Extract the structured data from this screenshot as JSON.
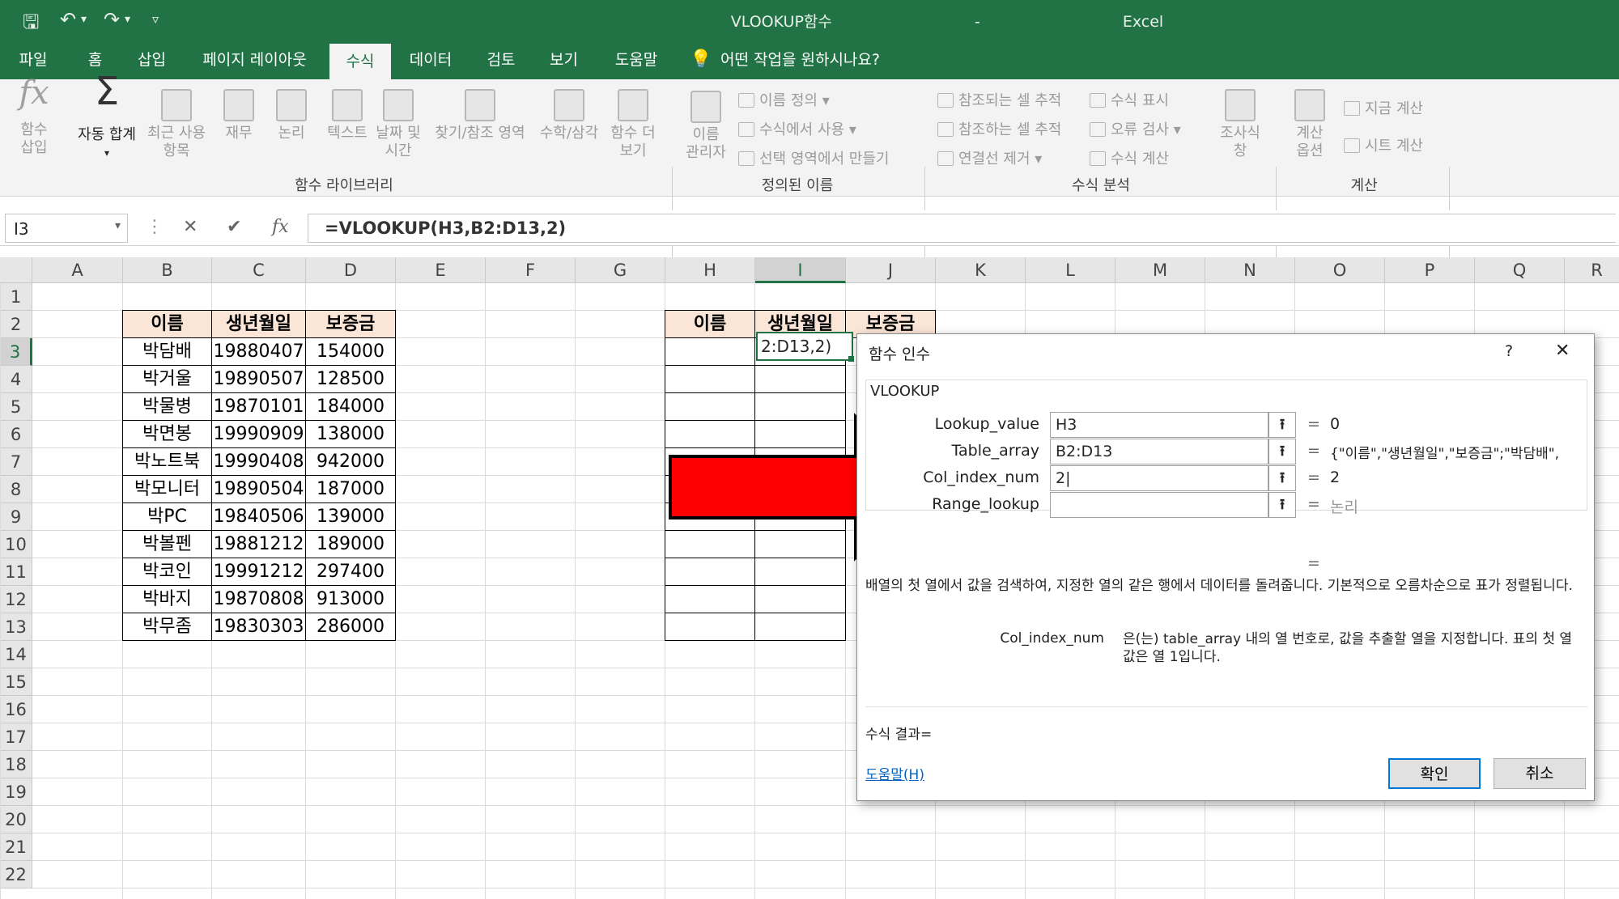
{
  "window": {
    "title": "VLOOKUP함수",
    "app": "Excel",
    "sep": "-"
  },
  "qat": {
    "save_icon": "save-icon",
    "undo_icon": "undo-icon",
    "redo_icon": "redo-icon"
  },
  "tabs": [
    {
      "label": "파일"
    },
    {
      "label": "홈"
    },
    {
      "label": "삽입"
    },
    {
      "label": "페이지 레이아웃"
    },
    {
      "label": "수식",
      "active": true
    },
    {
      "label": "데이터"
    },
    {
      "label": "검토"
    },
    {
      "label": "보기"
    },
    {
      "label": "도움말"
    }
  ],
  "tell_me": "어떤 작업을 원하시나요?",
  "ribbon": {
    "lib": {
      "insert_fn": "함수\n삽입",
      "autosum": "자동 합계",
      "recent": "최근 사용\n항목",
      "finance": "재무",
      "logic": "논리",
      "text": "텍스트",
      "datetime": "날짜 및\n시간",
      "lookup": "찾기/참조 영역",
      "math": "수학/삼각",
      "more": "함수 더\n보기",
      "group": "함수 라이브러리"
    },
    "names": {
      "manager": "이름\n관리자",
      "define": "이름 정의",
      "use": "수식에서 사용",
      "create": "선택 영역에서 만들기",
      "group": "정의된 이름"
    },
    "audit": {
      "precedents": "참조되는 셀 추적",
      "dependents": "참조하는 셀 추적",
      "remove": "연결선 제거",
      "show": "수식 표시",
      "error": "오류 검사",
      "evaluate": "수식 계산",
      "watch": "조사식\n창",
      "group": "수식 분석"
    },
    "calc": {
      "options": "계산\n옵션",
      "now": "지금 계산",
      "sheet": "시트 계산",
      "group": "계산"
    }
  },
  "formula_bar": {
    "name_box": "I3",
    "formula": "=VLOOKUP(H3,B2:D13,2)"
  },
  "columns": [
    "A",
    "B",
    "C",
    "D",
    "E",
    "F",
    "G",
    "H",
    "I",
    "J",
    "K",
    "L",
    "M",
    "N",
    "O",
    "P",
    "Q",
    "R"
  ],
  "rows": [
    "1",
    "2",
    "3",
    "4",
    "5",
    "6",
    "7",
    "8",
    "9",
    "10",
    "11",
    "12",
    "13",
    "14",
    "15",
    "16",
    "17",
    "18",
    "19",
    "20",
    "21",
    "22"
  ],
  "table": {
    "headers": [
      "이름",
      "생년월일",
      "보증금"
    ],
    "rows": [
      [
        "박담배",
        "19880407",
        "154000"
      ],
      [
        "박거울",
        "19890507",
        "128500"
      ],
      [
        "박물병",
        "19870101",
        "184000"
      ],
      [
        "박면봉",
        "19990909",
        "138000"
      ],
      [
        "박노트북",
        "19990408",
        "942000"
      ],
      [
        "박모니터",
        "19890504",
        "187000"
      ],
      [
        "박PC",
        "19840506",
        "139000"
      ],
      [
        "박볼펜",
        "19881212",
        "189000"
      ],
      [
        "박코인",
        "19991212",
        "297400"
      ],
      [
        "박바지",
        "19870808",
        "913000"
      ],
      [
        "박무좀",
        "19830303",
        "286000"
      ]
    ]
  },
  "lookup_headers": [
    "이름",
    "생년월일",
    "보증금"
  ],
  "cell_i3": "2:D13,2)",
  "dialog": {
    "title": "함수 인수",
    "help": "?",
    "close": "✕",
    "function": "VLOOKUP",
    "args": [
      {
        "label": "Lookup_value",
        "value": "H3",
        "result": "0"
      },
      {
        "label": "Table_array",
        "value": "B2:D13",
        "result": "{\"이름\",\"생년월일\",\"보증금\";\"박담배\","
      },
      {
        "label": "Col_index_num",
        "value": "2",
        "result": "2"
      },
      {
        "label": "Range_lookup",
        "value": "",
        "result": "논리"
      }
    ],
    "eq": "=",
    "description": "배열의 첫 열에서 값을 검색하여, 지정한 열의 같은 행에서 데이터를 돌려줍니다. 기본적으로 오름차순으로 표가 정렬됩니다.",
    "arg_name": "Col_index_num",
    "arg_desc": "은(는) table_array 내의 열 번호로, 값을 추출할 열을 지정합니다. 표의 첫 열 값은 열 1입니다.",
    "result_label": "수식 결과=",
    "help_link": "도움말(H)",
    "ok": "확인",
    "cancel": "취소"
  },
  "annotation": {
    "arrow_color": "#ff0000"
  }
}
